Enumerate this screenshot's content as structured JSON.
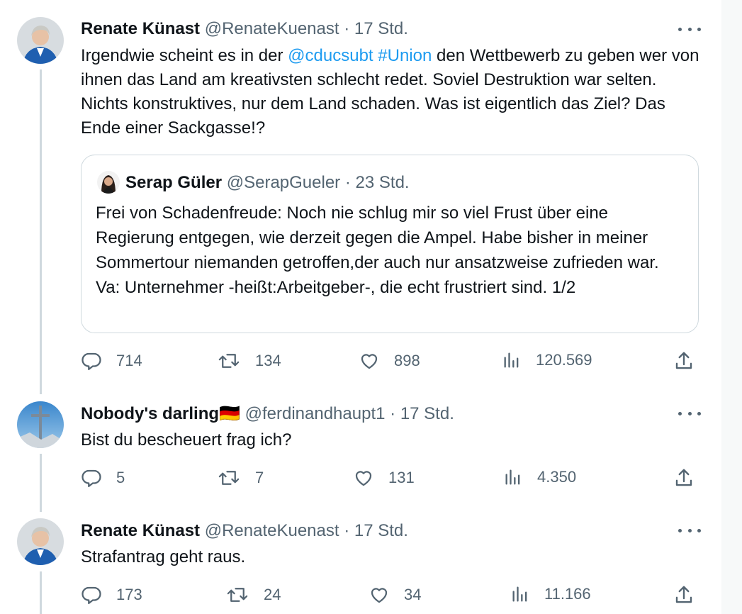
{
  "tweets": [
    {
      "name": "Renate Künast",
      "handle": "@RenateKuenast",
      "sep": "·",
      "time": "17 Std.",
      "text_pre": "Irgendwie scheint es in der ",
      "mention": "@cducsubt",
      "space": " ",
      "hashtag": "#Union",
      "text_post": " den Wettbewerb zu geben wer von ihnen das Land am kreativsten schlecht redet. Soviel Destruktion war selten. Nichts konstruktives, nur dem Land schaden. Was ist eigentlich das Ziel? Das Ende einer Sackgasse!?",
      "quote": {
        "name": "Serap Güler",
        "handle": "@SerapGueler",
        "sep": "·",
        "time": "23 Std.",
        "text": "Frei von Schadenfreude: Noch nie schlug mir so viel Frust über eine Regierung entgegen, wie derzeit gegen die Ampel. Habe bisher in meiner Sommertour niemanden getroffen,der auch nur ansatzweise zufrieden war.\nVa: Unternehmer -heißt:Arbeitgeber-, die echt frustriert sind. 1/2"
      },
      "stats": {
        "replies": "714",
        "retweets": "134",
        "likes": "898",
        "views": "120.569"
      }
    },
    {
      "name": "Nobody's darling",
      "flag": "🇩🇪",
      "handle": "@ferdinandhaupt1",
      "sep": "·",
      "time": "17 Std.",
      "text": "Bist du bescheuert frag ich?",
      "stats": {
        "replies": "5",
        "retweets": "7",
        "likes": "131",
        "views": "4.350"
      }
    },
    {
      "name": "Renate Künast",
      "handle": "@RenateKuenast",
      "sep": "·",
      "time": "17 Std.",
      "text": "Strafantrag geht raus.",
      "stats": {
        "replies": "173",
        "retweets": "24",
        "likes": "34",
        "views": "11.166"
      }
    }
  ],
  "icons": {
    "reply": "reply-icon",
    "retweet": "retweet-icon",
    "like": "heart-icon",
    "views": "analytics-icon",
    "share": "share-icon",
    "more": "more-icon"
  },
  "colors": {
    "link": "#1d9bf0",
    "secondary": "#536471",
    "border": "#cfd9de"
  }
}
